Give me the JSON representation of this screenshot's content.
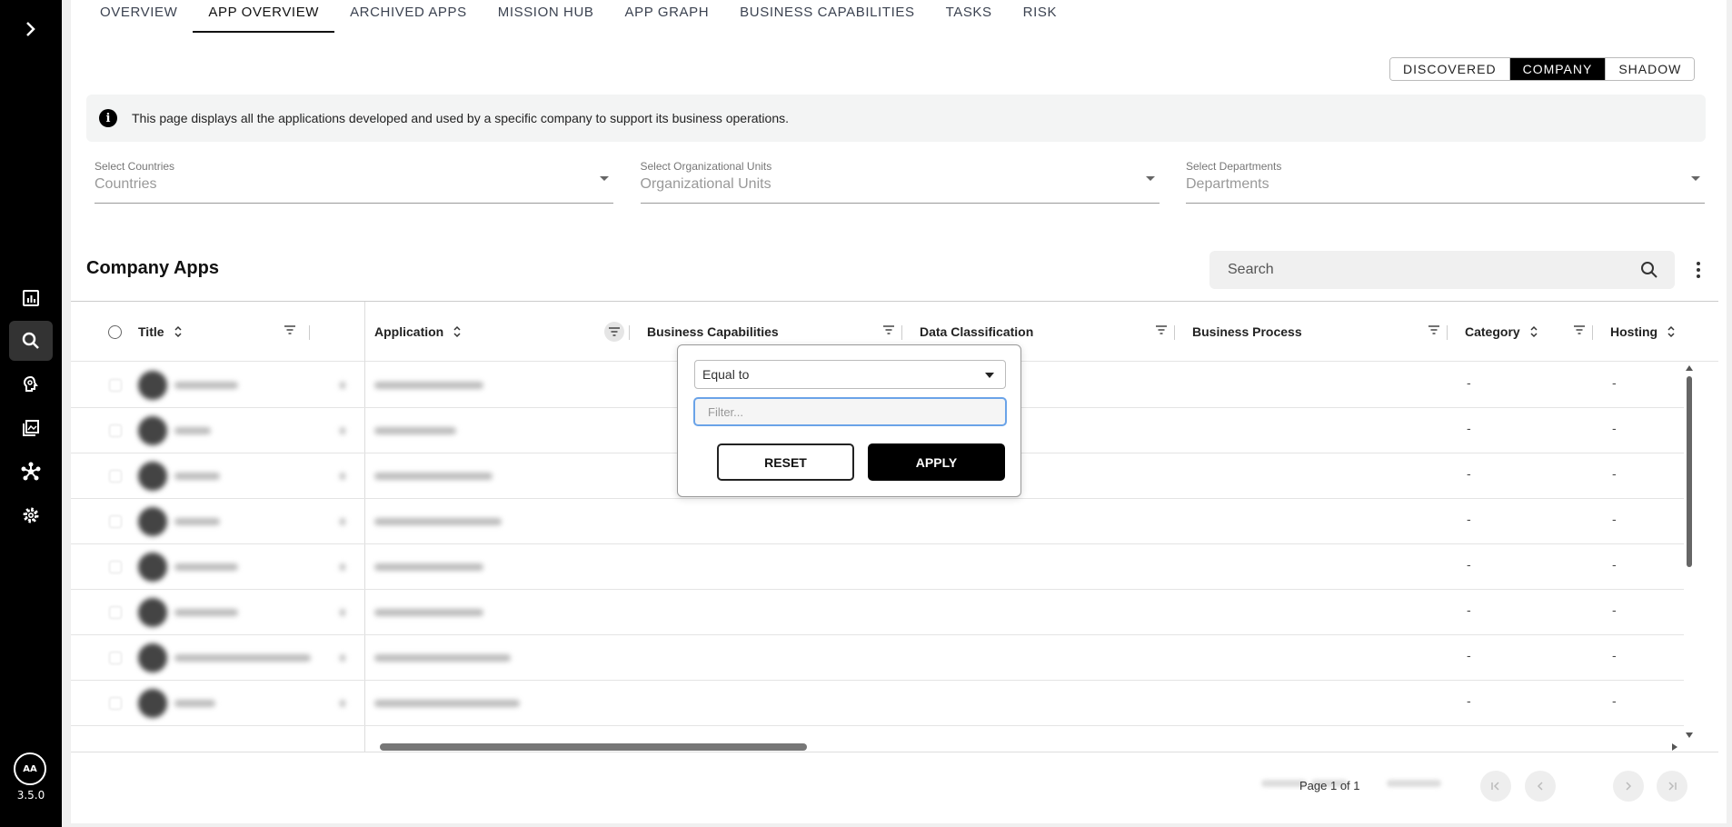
{
  "sidebar": {
    "icons": [
      "chevron-right-icon",
      "chart-icon",
      "search-icon",
      "brain-icon",
      "gallery-icon",
      "network-icon",
      "gear-icon"
    ],
    "avatar_initials": "AA",
    "version": "3.5.0"
  },
  "tabs": [
    {
      "label": "OVERVIEW"
    },
    {
      "label": "APP OVERVIEW"
    },
    {
      "label": "ARCHIVED APPS"
    },
    {
      "label": "MISSION HUB"
    },
    {
      "label": "APP GRAPH"
    },
    {
      "label": "BUSINESS CAPABILITIES"
    },
    {
      "label": "TASKS"
    },
    {
      "label": "RISK"
    }
  ],
  "active_tab": "APP OVERVIEW",
  "view_toggle": {
    "options": [
      "DISCOVERED",
      "COMPANY",
      "SHADOW"
    ],
    "selected": "COMPANY"
  },
  "info": {
    "text": "This page displays all the applications developed and used by a specific company to support its business operations."
  },
  "filters": [
    {
      "label": "Select Countries",
      "placeholder": "Countries"
    },
    {
      "label": "Select Organizational Units",
      "placeholder": "Organizational Units"
    },
    {
      "label": "Select Departments",
      "placeholder": "Departments"
    }
  ],
  "section": {
    "title": "Company Apps",
    "search_placeholder": "Search"
  },
  "table": {
    "columns": [
      "Title",
      "Application",
      "Business Capabilities",
      "Data Classification",
      "Business Process",
      "Category",
      "Hosting"
    ],
    "rows": [
      {
        "category": "-",
        "hosting": "-"
      },
      {
        "category": "-",
        "hosting": "-"
      },
      {
        "category": "-",
        "hosting": "-"
      },
      {
        "category": "-",
        "hosting": "-"
      },
      {
        "category": "-",
        "hosting": "-"
      },
      {
        "category": "-",
        "hosting": "-"
      },
      {
        "category": "-",
        "hosting": "-"
      },
      {
        "category": "-",
        "hosting": "-"
      }
    ]
  },
  "popover": {
    "operator": "Equal to",
    "input_placeholder": "Filter...",
    "reset_label": "RESET",
    "apply_label": "APPLY"
  },
  "pager": {
    "page_label": "Page 1 of 1"
  },
  "colors": {
    "sidebar_bg": "#000000",
    "accent": "#000000",
    "focus_ring": "#6aa3e8"
  }
}
